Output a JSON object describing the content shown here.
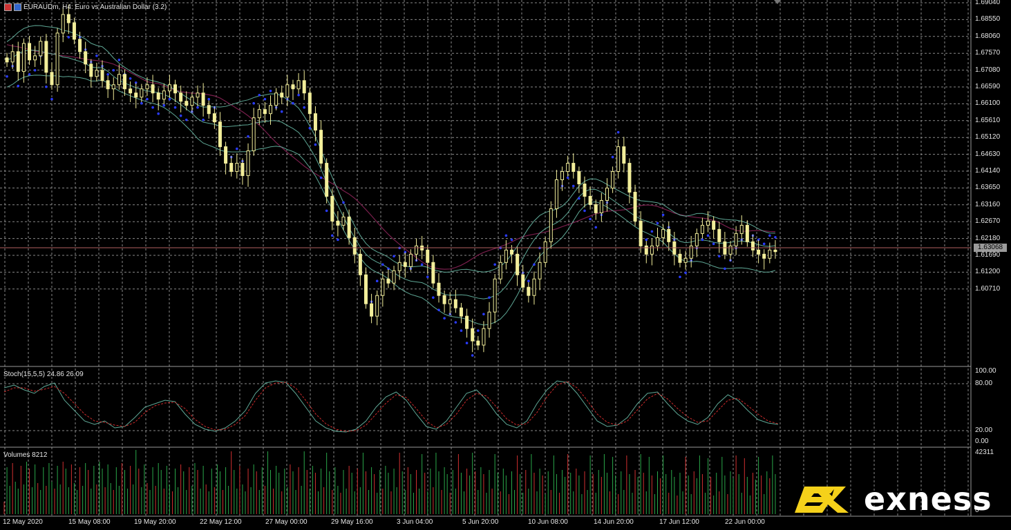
{
  "window": {
    "symbol_title": "EURAUDm, H4:  Euro vs Australian Dollar (3.2)"
  },
  "price_axis": {
    "labels": [
      "1.69040",
      "1.68550",
      "1.68060",
      "1.67570",
      "1.67080",
      "1.66590",
      "1.66100",
      "1.65610",
      "1.65120",
      "1.64630",
      "1.64140",
      "1.63650",
      "1.63160",
      "1.62670",
      "1.62180",
      "1.61690",
      "1.61200",
      "1.60710"
    ],
    "current_price": "1.63068"
  },
  "stoch": {
    "label": "Stoch(15,5,5) 24.86 26.09",
    "levels": [
      "100.00",
      "80.00",
      "20.00",
      "0.00"
    ]
  },
  "volumes": {
    "label": "Volumes 8212",
    "max_label": "42311",
    "zero_label": "0"
  },
  "time_axis": {
    "labels": [
      "12 May 2020",
      "15 May 08:00",
      "19 May 20:00",
      "22 May 12:00",
      "27 May 00:00",
      "29 May 16:00",
      "3 Jun 04:00",
      "5 Jun 20:00",
      "10 Jun 08:00",
      "14 Jun 20:00",
      "17 Jun 12:00",
      "22 Jun 00:00"
    ]
  },
  "brand": {
    "name": "exness"
  },
  "colors": {
    "background": "#000000",
    "grid": "#8a8a8a",
    "candle": "#f2ee9a",
    "psar": "#2a3cff",
    "bollinger": "#5fa896",
    "moving_average": "#7a1f4d",
    "current_price_line": "#b46060",
    "stoch_main": "#5fa896",
    "stoch_signal": "#cc2b2b",
    "volume_up": "#2aa84a",
    "volume_down": "#d23030",
    "logo_yellow": "#f5d11a"
  },
  "chart_data": {
    "type": "candlestick",
    "symbol": "EURAUDm",
    "timeframe": "H4",
    "ylim": [
      1.603,
      1.691
    ],
    "closes": [
      1.6765,
      1.679,
      1.6742,
      1.681,
      1.677,
      1.678,
      1.6815,
      1.674,
      1.671,
      1.6835,
      1.688,
      1.686,
      1.682,
      1.679,
      1.676,
      1.673,
      1.6745,
      1.672,
      1.67,
      1.671,
      1.6735,
      1.67,
      1.669,
      1.668,
      1.67,
      1.671,
      1.669,
      1.6675,
      1.6695,
      1.671,
      1.669,
      1.667,
      1.666,
      1.668,
      1.669,
      1.666,
      1.664,
      1.662,
      1.656,
      1.652,
      1.65,
      1.652,
      1.649,
      1.655,
      1.663,
      1.665,
      1.664,
      1.666,
      1.669,
      1.668,
      1.671,
      1.67,
      1.672,
      1.669,
      1.664,
      1.66,
      1.652,
      1.644,
      1.638,
      1.637,
      1.639,
      1.634,
      1.63,
      1.625,
      1.618,
      1.615,
      1.62,
      1.624,
      1.623,
      1.626,
      1.628,
      1.627,
      1.63,
      1.632,
      1.631,
      1.628,
      1.623,
      1.62,
      1.618,
      1.619,
      1.617,
      1.615,
      1.612,
      1.609,
      1.608,
      1.612,
      1.616,
      1.624,
      1.628,
      1.631,
      1.63,
      1.625,
      1.622,
      1.62,
      1.624,
      1.628,
      1.633,
      1.641,
      1.648,
      1.65,
      1.652,
      1.65,
      1.647,
      1.644,
      1.642,
      1.64,
      1.643,
      1.646,
      1.65,
      1.656,
      1.652,
      1.645,
      1.638,
      1.632,
      1.63,
      1.632,
      1.634,
      1.636,
      1.633,
      1.63,
      1.628,
      1.629,
      1.632,
      1.635,
      1.637,
      1.638,
      1.636,
      1.633,
      1.63,
      1.632,
      1.635,
      1.637,
      1.633,
      1.631,
      1.63,
      1.629,
      1.631,
      1.6306
    ],
    "stoch_main": [
      78,
      82,
      75,
      70,
      80,
      85,
      60,
      45,
      30,
      25,
      30,
      20,
      22,
      35,
      50,
      55,
      60,
      58,
      40,
      25,
      18,
      15,
      20,
      30,
      45,
      70,
      85,
      88,
      86,
      70,
      50,
      30,
      20,
      15,
      14,
      18,
      30,
      50,
      65,
      72,
      60,
      40,
      22,
      18,
      30,
      50,
      70,
      75,
      60,
      40,
      25,
      20,
      30,
      55,
      75,
      88,
      86,
      70,
      50,
      30,
      22,
      24,
      35,
      55,
      70,
      72,
      55,
      40,
      30,
      25,
      35,
      55,
      68,
      60,
      45,
      32,
      27,
      25
    ],
    "stoch_signal": [
      72,
      78,
      78,
      73,
      76,
      80,
      70,
      55,
      40,
      30,
      28,
      24,
      22,
      28,
      42,
      52,
      56,
      57,
      48,
      32,
      22,
      17,
      18,
      25,
      38,
      60,
      78,
      85,
      86,
      78,
      60,
      40,
      26,
      18,
      15,
      16,
      24,
      40,
      56,
      68,
      64,
      48,
      30,
      20,
      25,
      40,
      60,
      70,
      66,
      50,
      33,
      24,
      26,
      42,
      65,
      82,
      87,
      78,
      60,
      40,
      28,
      24,
      30,
      46,
      62,
      70,
      62,
      48,
      36,
      28,
      30,
      45,
      60,
      63,
      52,
      40,
      30,
      26
    ]
  }
}
